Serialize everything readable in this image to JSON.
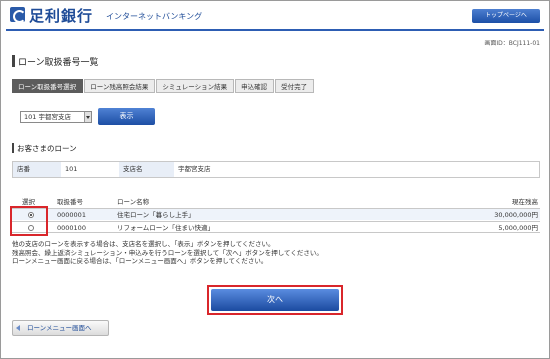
{
  "header": {
    "bank_name": "足利銀行",
    "service_name": "インターネットバンキング",
    "top_page_button": "トップページへ",
    "screen_id": "画面ID：BCJ111-01"
  },
  "page": {
    "title": "ローン取扱番号一覧"
  },
  "steps": [
    {
      "label": "ローン取扱番号選択",
      "active": true
    },
    {
      "label": "ローン残高照会結果",
      "active": false
    },
    {
      "label": "シミュレーション結果",
      "active": false
    },
    {
      "label": "申込確認",
      "active": false
    },
    {
      "label": "受付完了",
      "active": false
    }
  ],
  "branch_select": {
    "selected": "101 宇都宮支店",
    "display_button": "表示"
  },
  "customer_loans": {
    "section_title": "お客さまのローン",
    "store_label": "店番",
    "store_value": "101",
    "branch_label": "支店名",
    "branch_value": "宇都宮支店"
  },
  "loan_table": {
    "headers": [
      "選択",
      "取扱番号",
      "ローン名称",
      "現在残高"
    ],
    "rows": [
      {
        "selected": true,
        "number": "0000001",
        "name": "住宅ローン「暮らし上手」",
        "balance": "30,000,000円"
      },
      {
        "selected": false,
        "number": "0000100",
        "name": "リフォームローン「住まい快適」",
        "balance": "5,000,000円"
      }
    ]
  },
  "notes": [
    "他の支店のローンを表示する場合は、支店名を選択し、「表示」ボタンを押してください。",
    "残高照会、繰上返済シミュレーション・申込みを行うローンを選択して「次へ」ボタンを押してください。",
    "ローンメニュー画面に戻る場合は、「ローンメニュー画面へ」ボタンを押してください。"
  ],
  "buttons": {
    "next": "次へ",
    "back_to_menu": "ローンメニュー画面へ"
  },
  "colors": {
    "brand_blue": "#1f4c98",
    "button_blue": "#1d4ea4",
    "highlight_red": "#d9262b"
  }
}
